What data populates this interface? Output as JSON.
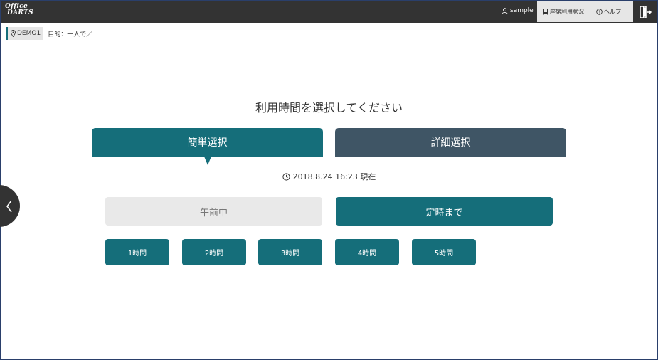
{
  "header": {
    "logo_line1": "Office",
    "logo_line2": "DARTS",
    "user_name": "sample",
    "seat_status_label": "座席利用状況",
    "help_label": "ヘルプ",
    "icons": {
      "user": "user-icon",
      "seat": "seat-icon",
      "help": "help-icon",
      "logout": "logout-icon"
    }
  },
  "breadcrumb": {
    "store": "DEMO1",
    "purpose": "目的：一人で／"
  },
  "main": {
    "heading": "利用時間を選択してください",
    "tabs": [
      {
        "label": "簡単選択",
        "active": true
      },
      {
        "label": "詳細選択",
        "active": false
      }
    ],
    "current_time": "2018.8.24 16:23 現在",
    "presets": {
      "morning": "午前中",
      "until_close": "定時まで"
    },
    "hour_buttons": [
      "1時間",
      "2時間",
      "3時間",
      "4時間",
      "5時間"
    ]
  },
  "colors": {
    "primary": "#156e7a",
    "secondary": "#3f5565",
    "topbar": "#333333",
    "disabled": "#e9e9e9"
  }
}
